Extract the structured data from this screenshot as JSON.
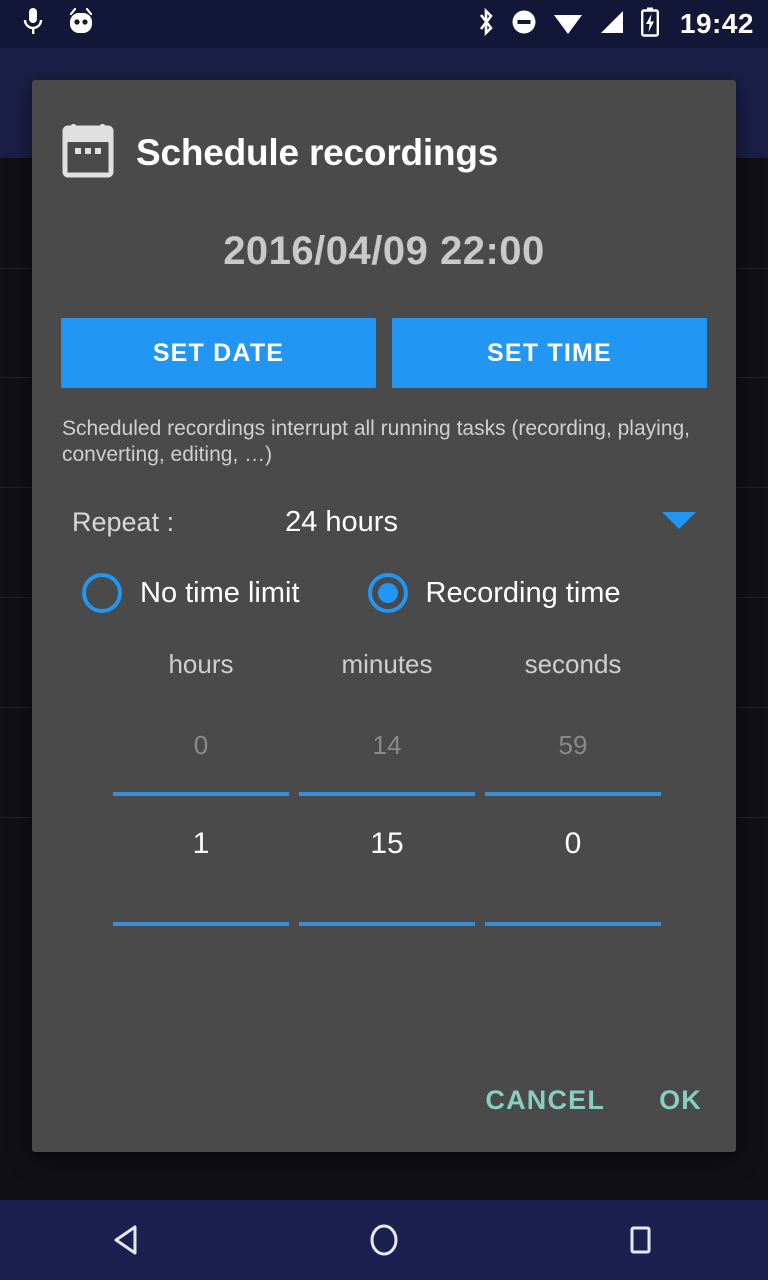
{
  "status_bar": {
    "left_icons": [
      "microphone-icon",
      "android-head-icon"
    ],
    "right_icons": [
      "bluetooth-icon",
      "do-not-disturb-icon",
      "wifi-icon",
      "cellular-signal-icon",
      "battery-charging-icon"
    ],
    "clock": "19:42"
  },
  "dialog": {
    "icon": "calendar-icon",
    "title": "Schedule recordings",
    "datetime": "2016/04/09 22:00",
    "set_date_label": "SET DATE",
    "set_time_label": "SET TIME",
    "note": "Scheduled recordings interrupt all running tasks (recording, playing, converting, editing, …)",
    "repeat": {
      "label": "Repeat :",
      "value": "24 hours",
      "caret_icon": "chevron-down-icon"
    },
    "radios": [
      {
        "label": "No time limit",
        "selected": false
      },
      {
        "label": "Recording time",
        "selected": true
      }
    ],
    "duration_picker": {
      "columns": [
        {
          "header": "hours",
          "previous": "0",
          "current": "1"
        },
        {
          "header": "minutes",
          "previous": "14",
          "current": "15"
        },
        {
          "header": "seconds",
          "previous": "59",
          "current": "0"
        }
      ]
    },
    "cancel_label": "CANCEL",
    "ok_label": "OK"
  },
  "nav_bar": {
    "back": "back-icon",
    "home": "home-icon",
    "recents": "recents-icon"
  },
  "colors": {
    "accent_blue": "#2196f3",
    "dialog_bg": "#4a4a4a",
    "action_teal": "#87cec4",
    "status_navy": "#121637",
    "nav_navy": "#1b2050"
  }
}
